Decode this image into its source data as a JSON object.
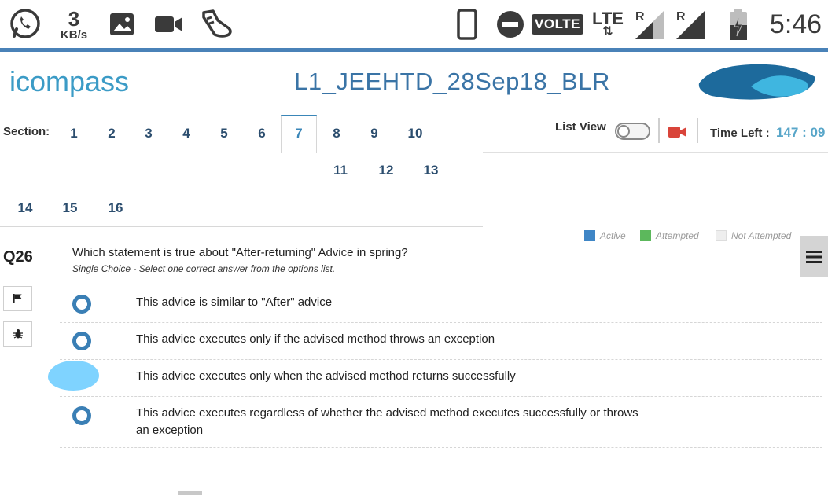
{
  "status_bar": {
    "net_speed_value": "3",
    "net_speed_unit": "KB/s",
    "volte": "VOLTE",
    "lte": "LTE",
    "lte_arrows": "⇅",
    "roaming_1": "R",
    "roaming_2": "R",
    "time": "5:46",
    "icons": [
      "whatsapp-icon",
      "image-icon",
      "video-camera-icon",
      "shoe-icon",
      "phone-icon",
      "do-not-disturb-icon",
      "signal-icon",
      "battery-charging-icon"
    ]
  },
  "header": {
    "logo_text": "icompass",
    "title": "L1_JEEHTD_28Sep18_BLR"
  },
  "sections": {
    "label": "Section:",
    "items": [
      "1",
      "2",
      "3",
      "4",
      "5",
      "6",
      "7",
      "8",
      "9",
      "10",
      "11",
      "12",
      "13",
      "14",
      "15",
      "16"
    ],
    "active": "7"
  },
  "controls": {
    "list_view_label": "List View",
    "list_view_on": false,
    "time_left_label": "Time Left :",
    "time_left_value": "147 : 09"
  },
  "legend": {
    "items": [
      {
        "label": "Active",
        "color": "#3f86c6"
      },
      {
        "label": "Attempted",
        "color": "#5cb85c"
      },
      {
        "label": "Not Attempted",
        "color": "#eeeeee"
      }
    ]
  },
  "question": {
    "number": "Q26",
    "text": "Which statement is true about \"After-returning\" Advice in spring?",
    "hint": "Single Choice - Select one correct answer from the options list.",
    "options": [
      "This advice is similar to \"After\" advice",
      "This advice executes only if the advised method throws an exception",
      "This advice executes only when the advised method returns successfully",
      "This advice executes regardless of whether the advised method executes successfully or throws an exception"
    ]
  },
  "colors": {
    "accent": "#3a74a6",
    "radio": "#3a7fb5",
    "timer": "#58a6c9",
    "camera": "#d9443a"
  }
}
